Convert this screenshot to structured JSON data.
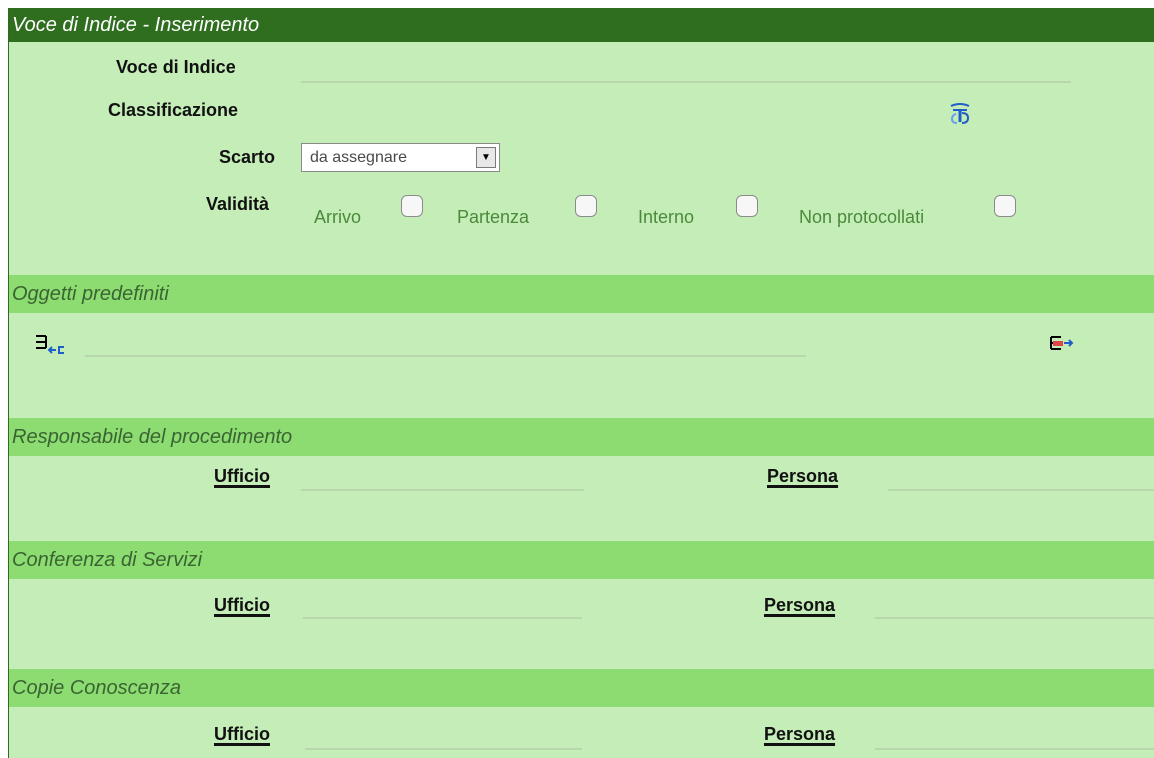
{
  "window_title": "Voce di Indice - Inserimento",
  "form": {
    "voce_label": "Voce di Indice",
    "voce_value": "",
    "classificazione_label": "Classificazione",
    "scarto_label": "Scarto",
    "scarto_selected": "da assegnare",
    "validita_label": "Validità",
    "validita_options": [
      "Arrivo",
      "Partenza",
      "Interno",
      "Non protocollati"
    ]
  },
  "sections": {
    "oggetti": {
      "title": "Oggetti predefiniti"
    },
    "responsabile": {
      "title": "Responsabile del procedimento",
      "ufficio": "Ufficio",
      "persona": "Persona"
    },
    "conferenza": {
      "title": "Conferenza di Servizi",
      "ufficio": "Ufficio",
      "persona": "Persona"
    },
    "copie": {
      "title": "Copie Conoscenza",
      "ufficio": "Ufficio",
      "persona": "Persona"
    }
  },
  "icons": {
    "classificazione": "thesaurus-icon",
    "oggetti_left": "insert-list-icon",
    "oggetti_right": "export-list-icon"
  }
}
